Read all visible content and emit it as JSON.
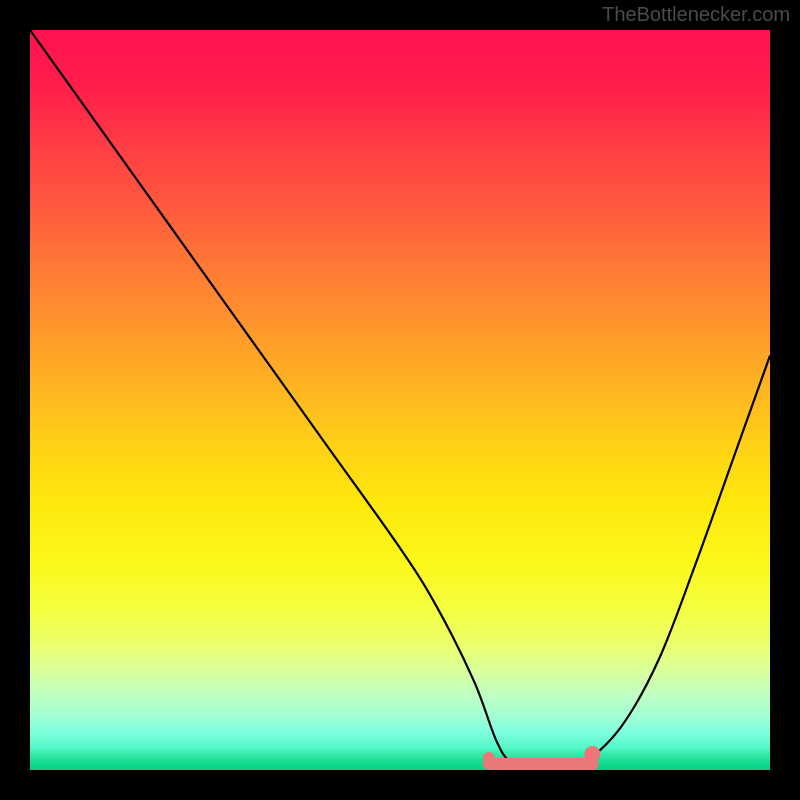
{
  "watermark": "TheBottlenecker.com",
  "chart_data": {
    "type": "line",
    "title": "",
    "xlabel": "",
    "ylabel": "",
    "xlim": [
      0,
      100
    ],
    "ylim": [
      0,
      100
    ],
    "series": [
      {
        "name": "bottleneck-curve",
        "x": [
          0,
          10,
          20,
          30,
          40,
          50,
          55,
          60,
          63,
          65,
          68,
          70,
          72,
          75,
          80,
          85,
          90,
          95,
          100
        ],
        "values": [
          100,
          86,
          72,
          58,
          44,
          30,
          22,
          12,
          4,
          1,
          0,
          0,
          0,
          1,
          6,
          15,
          28,
          42,
          56
        ]
      }
    ],
    "highlight_band": {
      "name": "optimal-range",
      "x_start": 62,
      "x_end": 76,
      "y": 0,
      "color": "#e97878"
    },
    "gradient_stops": [
      {
        "pct": 0,
        "color": "#ff1250"
      },
      {
        "pct": 50,
        "color": "#ffd016"
      },
      {
        "pct": 100,
        "color": "#06d283"
      }
    ]
  }
}
